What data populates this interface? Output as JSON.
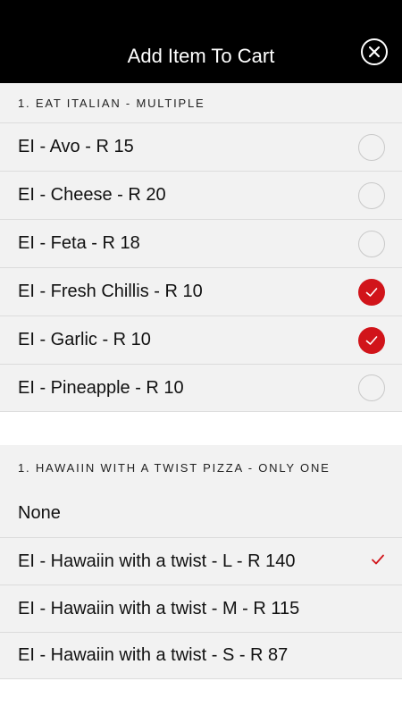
{
  "header": {
    "title": "Add Item To Cart",
    "close_icon": "close-icon"
  },
  "section1": {
    "title": "1. EAT ITALIAN - MULTIPLE",
    "items": [
      {
        "label": "EI - Avo  - R 15",
        "checked": false
      },
      {
        "label": "EI - Cheese  - R 20",
        "checked": false
      },
      {
        "label": "EI - Feta  - R 18",
        "checked": false
      },
      {
        "label": "EI - Fresh Chillis - R 10",
        "checked": true
      },
      {
        "label": "EI - Garlic - R 10",
        "checked": true
      },
      {
        "label": "EI - Pineapple  - R 10",
        "checked": false
      }
    ]
  },
  "section2": {
    "title": "1. HAWAIIN WITH A TWIST PIZZA - ONLY ONE",
    "items": [
      {
        "label": "None",
        "selected": false
      },
      {
        "label": "EI - Hawaiin with a twist - L - R 140",
        "selected": true
      },
      {
        "label": "EI - Hawaiin with a twist - M - R 115",
        "selected": false
      },
      {
        "label": "EI - Hawaiin with a twist - S - R 87",
        "selected": false
      }
    ]
  },
  "colors": {
    "accent": "#d1141a",
    "header_bg": "#000000",
    "section_bg": "#f2f2f2"
  }
}
